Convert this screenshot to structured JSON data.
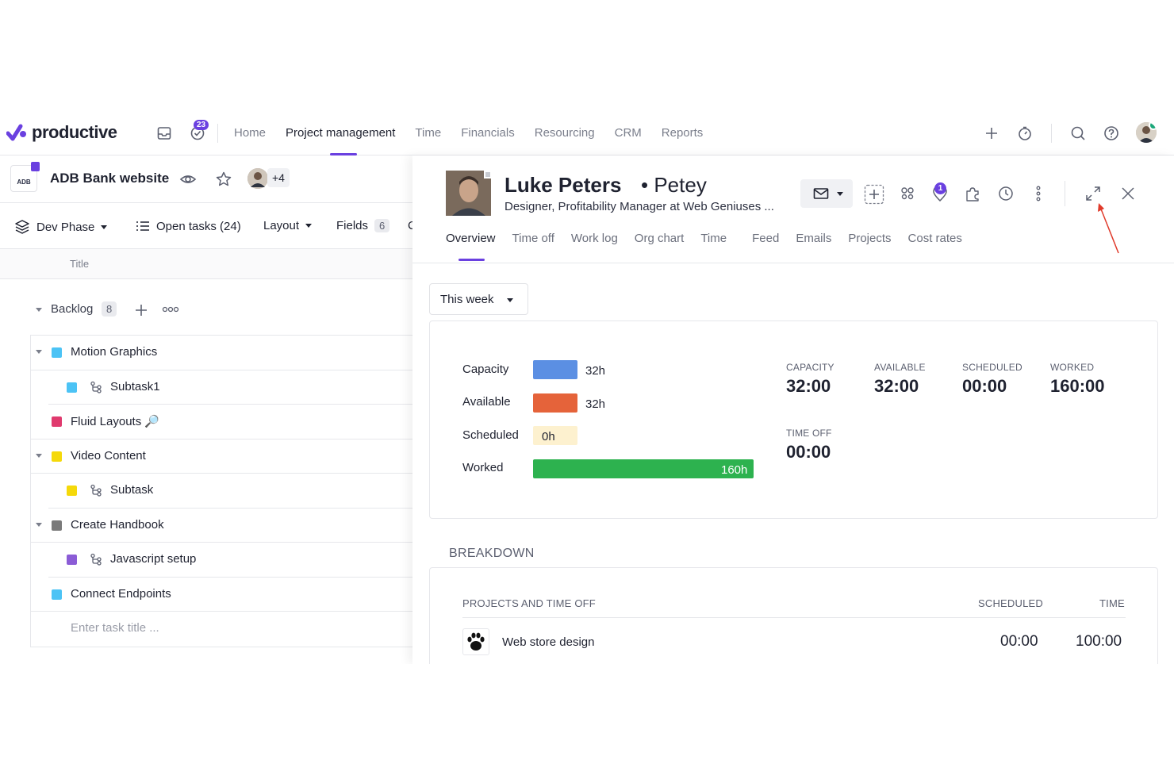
{
  "nav": {
    "logo": "productive",
    "inbox_badge": "23",
    "links": [
      "Home",
      "Project management",
      "Time",
      "Financials",
      "Resourcing",
      "CRM",
      "Reports"
    ],
    "active_link": "Project management"
  },
  "project": {
    "logo_text": "ADB",
    "logo_subtext": "Bank",
    "title": "ADB Bank website",
    "members_more": "+4"
  },
  "toolbar": {
    "phase": "Dev Phase",
    "open_tasks": "Open tasks (24)",
    "layout": "Layout",
    "fields": "Fields",
    "fields_count": "6",
    "cut_label": "C"
  },
  "columns": {
    "title": "Title"
  },
  "backlog": {
    "label": "Backlog",
    "count": "8"
  },
  "tasks": [
    {
      "title": "Motion Graphics",
      "color": "#4cc3f5",
      "sub": false,
      "expand": true
    },
    {
      "title": "Subtask1",
      "color": "#4cc3f5",
      "sub": true,
      "expand": false
    },
    {
      "title": "Fluid Layouts 🔎",
      "color": "#e03a6e",
      "sub": false,
      "expand": false
    },
    {
      "title": "Video Content",
      "color": "#f5d90a",
      "sub": false,
      "expand": true
    },
    {
      "title": "Subtask",
      "color": "#f5d90a",
      "sub": true,
      "expand": false
    },
    {
      "title": "Create Handbook",
      "color": "#7a7a7a",
      "sub": false,
      "expand": true
    },
    {
      "title": "Javascript setup",
      "color": "#8b5cd6",
      "sub": true,
      "expand": false
    },
    {
      "title": "Connect Endpoints",
      "color": "#4cc3f5",
      "sub": false,
      "expand": false
    }
  ],
  "task_input_placeholder": "Enter task title ...",
  "person": {
    "name": "Luke Peters",
    "separator": "•",
    "nickname": "Petey",
    "role": "Designer, Profitability Manager at Web Geniuses ...",
    "notification_badge": "1"
  },
  "tabs": [
    "Overview",
    "Time off",
    "Work log",
    "Org chart",
    "Time",
    "Feed",
    "Emails",
    "Projects",
    "Cost rates"
  ],
  "active_tab": "Overview",
  "period": "This week",
  "bars": [
    {
      "label": "Capacity",
      "value": "32h",
      "color": "#5b8fe3"
    },
    {
      "label": "Available",
      "value": "32h",
      "color": "#e5633a"
    },
    {
      "label": "Scheduled",
      "value": "0h",
      "color": "#fdf1cf"
    },
    {
      "label": "Worked",
      "value": "160h",
      "color": "#2db24f"
    }
  ],
  "stats": {
    "capacity_label": "CAPACITY",
    "capacity": "32:00",
    "available_label": "AVAILABLE",
    "available": "32:00",
    "scheduled_label": "SCHEDULED",
    "scheduled": "00:00",
    "worked_label": "WORKED",
    "worked": "160:00",
    "timeoff_label": "TIME OFF",
    "timeoff": "00:00"
  },
  "breakdown": {
    "title": "BREAKDOWN",
    "col_projects": "PROJECTS AND TIME OFF",
    "col_scheduled": "SCHEDULED",
    "col_time": "TIME",
    "rows": [
      {
        "name": "Web store design",
        "scheduled": "00:00",
        "time": "100:00"
      }
    ]
  },
  "colors": {
    "accent": "#6a40e0",
    "annotation_arrow": "#e03a2a"
  }
}
